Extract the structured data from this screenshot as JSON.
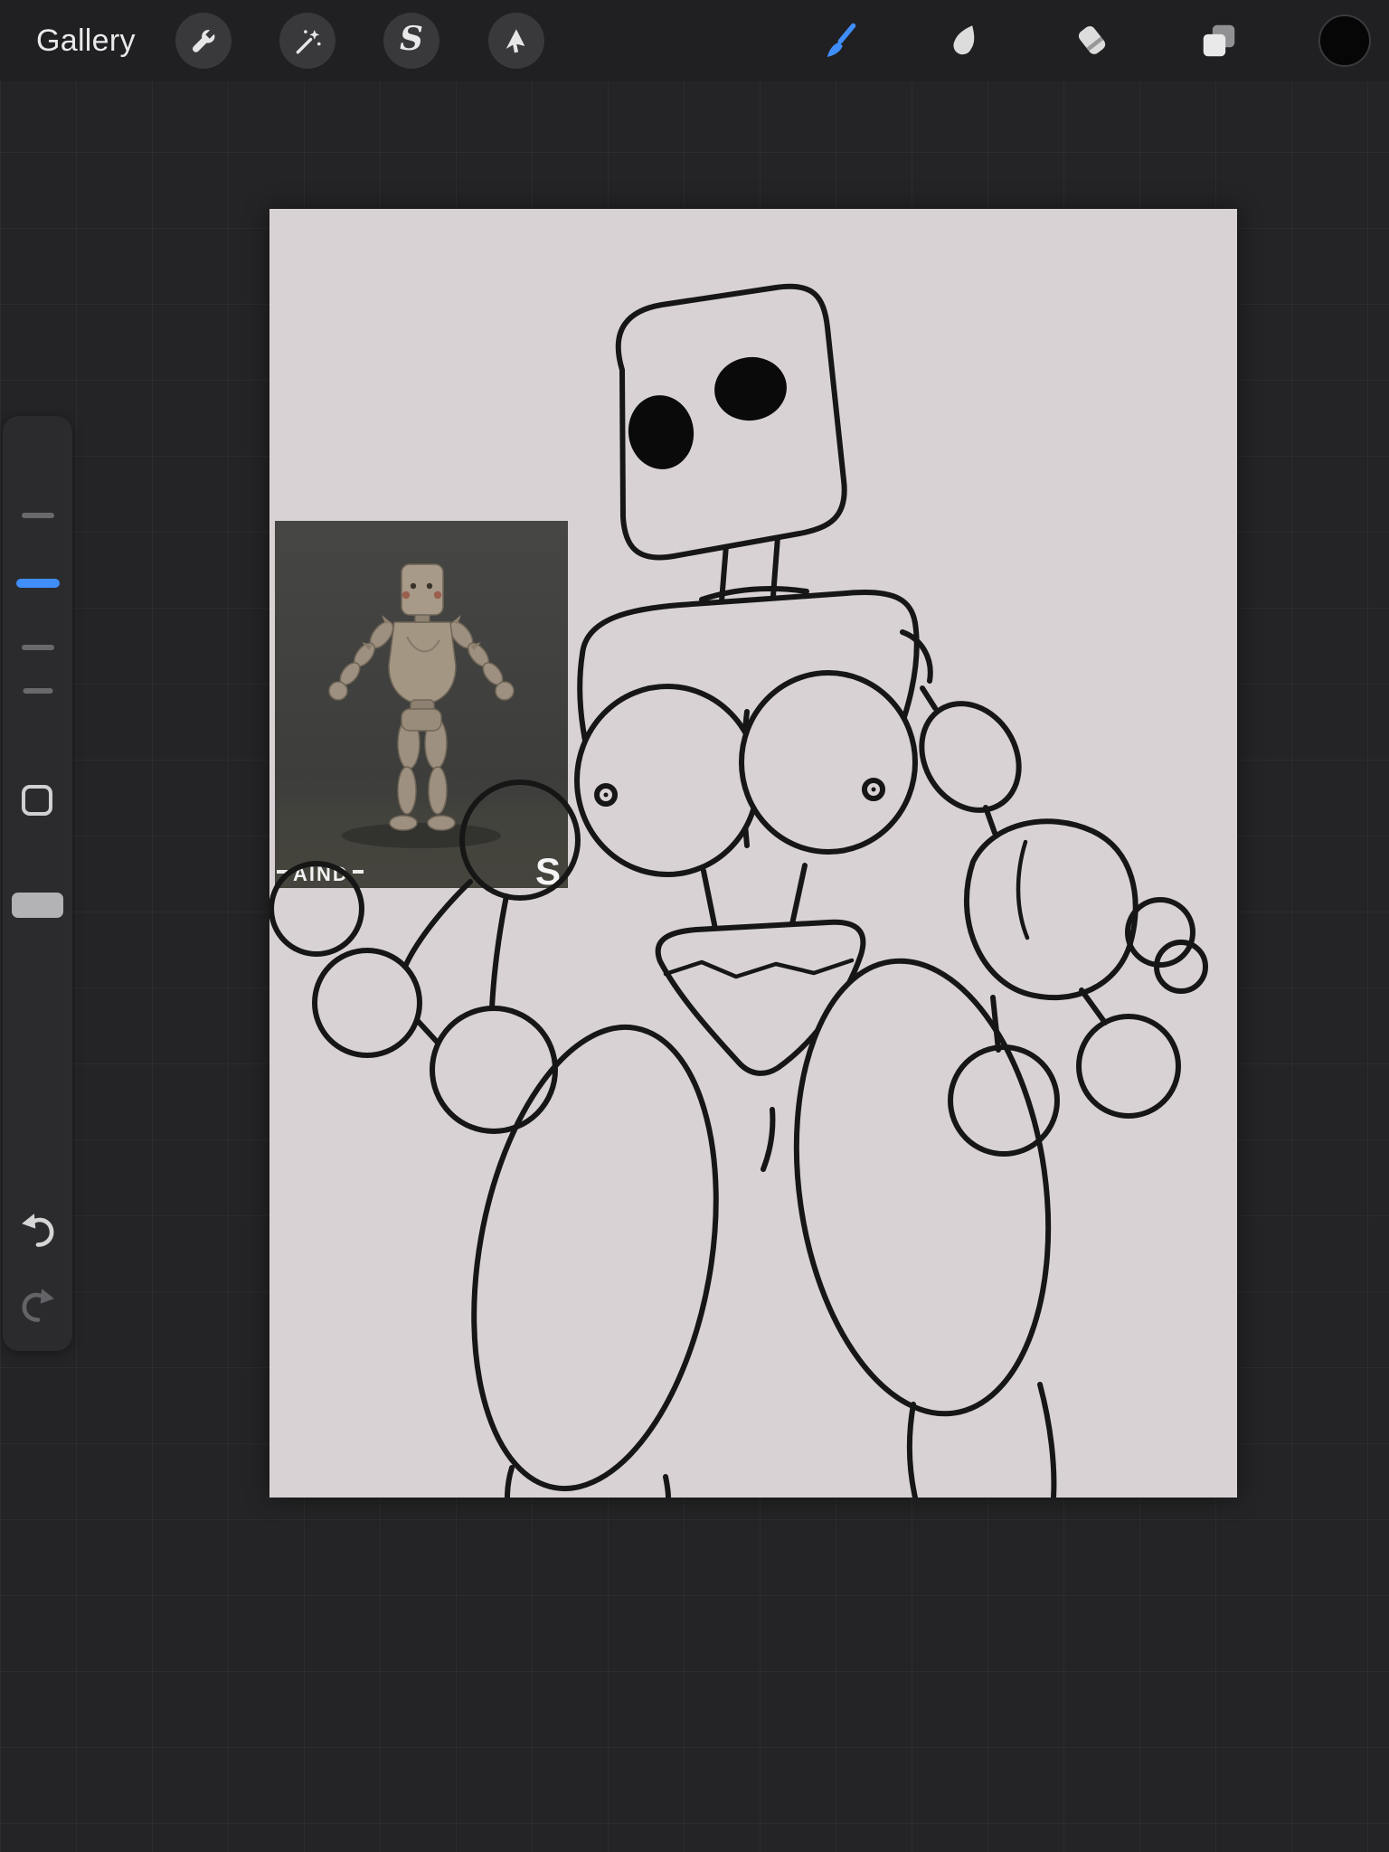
{
  "topbar": {
    "gallery_label": "Gallery",
    "selection_glyph": "S",
    "accent_color": "#3f8efc",
    "tools_left": [
      {
        "label": "actions"
      },
      {
        "label": "adjustments"
      },
      {
        "label": "selection"
      },
      {
        "label": "transform"
      }
    ],
    "tools_right": [
      {
        "label": "paint",
        "selected": true
      },
      {
        "label": "smudge",
        "selected": false
      },
      {
        "label": "erase",
        "selected": false
      },
      {
        "label": "layers",
        "selected": false
      },
      {
        "label": "color",
        "selected": false,
        "current_color": "#060607"
      }
    ]
  },
  "sidebar": {
    "slider_marks": 4,
    "active_mark_color": "#3f8efc"
  },
  "canvas": {
    "background_color": "#d8d2d4",
    "ink_color": "#161616"
  },
  "reference": {
    "caption_left": "AIND",
    "caption_right": "S"
  }
}
